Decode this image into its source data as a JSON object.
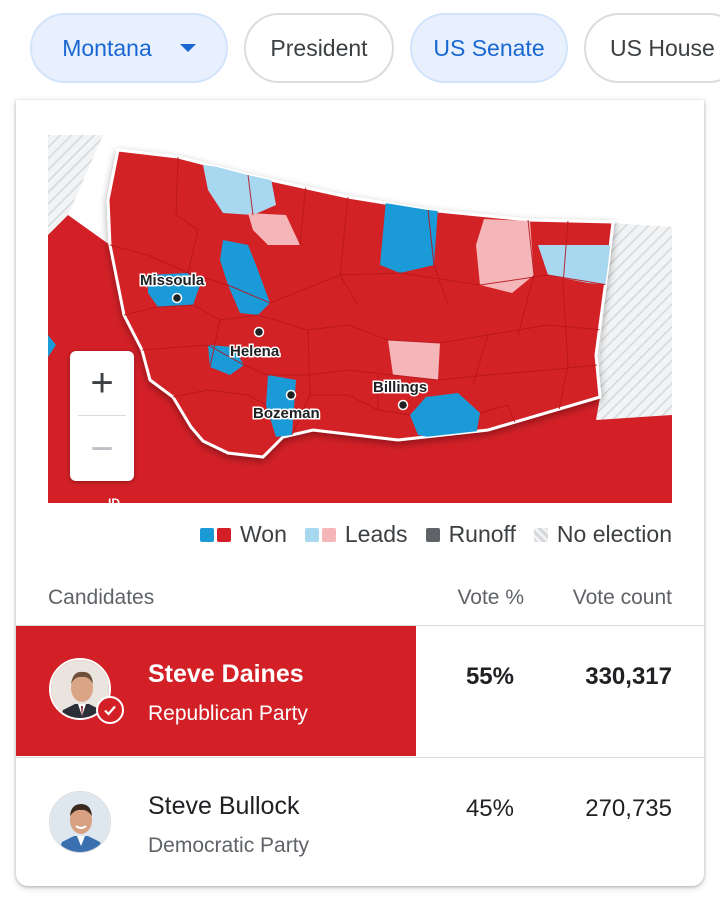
{
  "filters": {
    "state": "Montana",
    "tabs": [
      {
        "label": "President",
        "selected": false
      },
      {
        "label": "US Senate",
        "selected": true
      },
      {
        "label": "US House",
        "selected": false
      }
    ]
  },
  "map": {
    "cities": [
      "Missoula",
      "Helena",
      "Bozeman",
      "Billings"
    ],
    "neighbor_label": "ID",
    "zoom_in": "+",
    "zoom_out": "−"
  },
  "legend": {
    "won": "Won",
    "leads": "Leads",
    "runoff": "Runoff",
    "no_election": "No election"
  },
  "colors": {
    "republican": "#d32027",
    "democrat": "#1a9bd7",
    "rep_leads": "#f4b6b8",
    "dem_leads": "#a8d8f0",
    "runoff": "#5f6368",
    "chip_selected": "#1967d2"
  },
  "table": {
    "headers": {
      "candidates": "Candidates",
      "vote_pct": "Vote %",
      "vote_count": "Vote count"
    },
    "rows": [
      {
        "name": "Steve Daines",
        "party": "Republican Party",
        "pct": "55%",
        "count": "330,317",
        "winner": true
      },
      {
        "name": "Steve Bullock",
        "party": "Democratic Party",
        "pct": "45%",
        "count": "270,735",
        "winner": false
      }
    ]
  }
}
